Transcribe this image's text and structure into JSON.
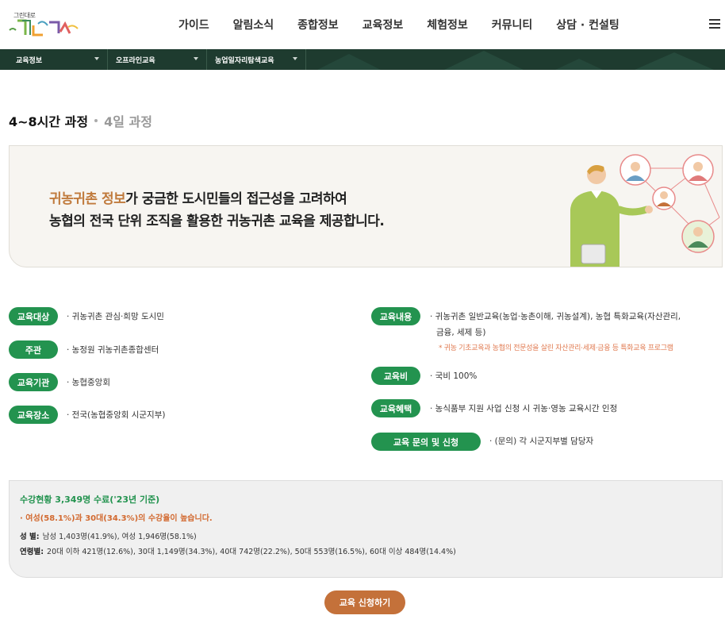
{
  "header": {
    "logo_small_text": "그린대로",
    "nav": [
      "가이드",
      "알림소식",
      "종합정보",
      "교육정보",
      "체험정보",
      "커뮤니티",
      "상담 · 컨설팅"
    ]
  },
  "subbar": {
    "crumbs": [
      "교육정보",
      "오프라인교육",
      "농업일자리탐색교육"
    ]
  },
  "tabs": {
    "active": "4~8시간 과정",
    "inactive": "4일 과정"
  },
  "intro": {
    "line1_accent": "귀농귀촌 정보",
    "line1_rest": "가 궁금한 도시민들의 접근성을 고려하여",
    "line2": "농협의 전국 단위 조직을 활용한 귀농귀촌 교육을 제공합니다."
  },
  "info_left": [
    {
      "label": "교육대상",
      "text": "· 귀농귀촌 관심·희망 도시민"
    },
    {
      "label": "주관",
      "text": "· 농정원 귀농귀촌종합센터"
    },
    {
      "label": "교육기관",
      "text": "· 농협중앙회"
    },
    {
      "label": "교육장소",
      "text": "· 전국(농협중앙회 시군지부)"
    }
  ],
  "info_right": [
    {
      "label": "교육내용",
      "text1": "· 귀농귀촌 일반교육(농업·농촌이해, 귀농설계), 농협 특화교육(자산관리,",
      "text2": "금융, 세제 등)",
      "note": "* 귀농 기초교육과 농협의 전문성을 살린 자산관리·세제·금융 등 특화교육 프로그램"
    },
    {
      "label": "교육비",
      "text": "· 국비 100%"
    },
    {
      "label": "교육혜택",
      "text": "· 농식품부 지원 사업 신청 시 귀농·영농 교육시간 인정"
    },
    {
      "label": "교육 문의 및 신청",
      "text": "· (문의) 각 시군지부별 담당자"
    }
  ],
  "stats": {
    "title": "수강현황 3,349명 수료('23년 기준)",
    "highlight": "· 여성(58.1%)과 30대(34.3%)의 수강율이 높습니다.",
    "gender_label": "성 별:",
    "gender_text": "남성 1,403명(41.9%), 여성 1,946명(58.1%)",
    "age_label": "연령별:",
    "age_text": "20대 이하 421명(12.6%), 30대 1,149명(34.3%), 40대 742명(22.2%), 50대 553명(16.5%), 60대 이상 484명(14.4%)"
  },
  "apply_button": "교육 신청하기",
  "colors": {
    "brand_green": "#23934f",
    "dark_green": "#1e3b2f",
    "accent_orange": "#c4713a"
  }
}
